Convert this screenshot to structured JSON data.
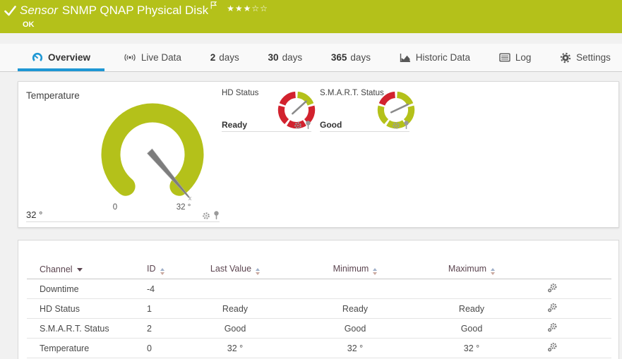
{
  "header": {
    "kind": "Sensor",
    "title": "SNMP QNAP Physical Disk",
    "status": "OK",
    "rating_filled": "★★★",
    "rating_empty": "☆☆",
    "bar_color": "#b4c11a"
  },
  "tabs": [
    {
      "icon": "gauge-icon",
      "label": "Overview",
      "active": true
    },
    {
      "icon": "live-icon",
      "label": "Live Data"
    },
    {
      "bold": "2",
      "label": "days"
    },
    {
      "bold": "30",
      "label": "days"
    },
    {
      "bold": "365",
      "label": "days"
    },
    {
      "icon": "chart-icon",
      "label": "Historic Data"
    },
    {
      "icon": "log-icon",
      "label": "Log"
    },
    {
      "icon": "gear-icon",
      "label": "Settings"
    }
  ],
  "gauges": {
    "temperature": {
      "title": "Temperature",
      "value": "32 °",
      "scale_min": "0",
      "scale_max": "32 °",
      "needle_marker": "x",
      "color": "#b4c11a"
    },
    "hd_status": {
      "title": "HD Status",
      "value": "Ready",
      "ok_color": "#b4c11a",
      "alarm_color": "#d2222e"
    },
    "smart_status": {
      "title": "S.M.A.R.T. Status",
      "value": "Good",
      "ok_color": "#b4c11a",
      "alarm_color": "#d2222e"
    }
  },
  "colors": {
    "accent_blue": "#1e97d4",
    "ok_green": "#b4c11a",
    "alarm_red": "#d2222e"
  },
  "table": {
    "headers": {
      "channel": "Channel",
      "id": "ID",
      "last_value": "Last Value",
      "minimum": "Minimum",
      "maximum": "Maximum"
    },
    "rows": [
      {
        "channel": "Downtime",
        "id": "-4",
        "last_value": "",
        "minimum": "",
        "maximum": ""
      },
      {
        "channel": "HD Status",
        "id": "1",
        "last_value": "Ready",
        "minimum": "Ready",
        "maximum": "Ready"
      },
      {
        "channel": "S.M.A.R.T. Status",
        "id": "2",
        "last_value": "Good",
        "minimum": "Good",
        "maximum": "Good"
      },
      {
        "channel": "Temperature",
        "id": "0",
        "last_value": "32 °",
        "minimum": "32 °",
        "maximum": "32 °"
      }
    ]
  }
}
